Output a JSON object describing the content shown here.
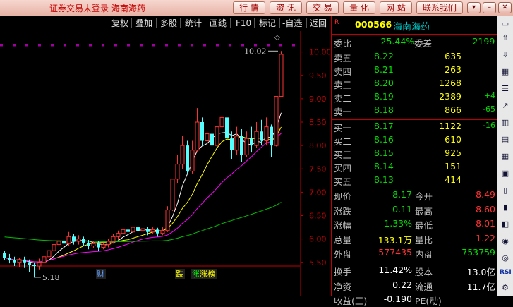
{
  "title": "证券交易未登录  海南海药",
  "top_buttons": [
    "行 情",
    "资 讯",
    "交 易",
    "量 化",
    "网 站",
    "联系我们"
  ],
  "toolbar": [
    "复权",
    "叠加",
    "多股",
    "统计",
    "画线",
    "F10",
    "标记",
    "-自选",
    "返回"
  ],
  "stock": {
    "badge": "R",
    "code": "000566",
    "name": "海南海药"
  },
  "webi": {
    "label1": "委比",
    "val1": "-25.44%",
    "label2": "委差",
    "val2": "-2199"
  },
  "asks": [
    {
      "label": "卖五",
      "price": "8.22",
      "vol": "635",
      "chg": ""
    },
    {
      "label": "卖四",
      "price": "8.21",
      "vol": "263",
      "chg": ""
    },
    {
      "label": "卖三",
      "price": "8.20",
      "vol": "1268",
      "chg": ""
    },
    {
      "label": "卖二",
      "price": "8.19",
      "vol": "2389",
      "chg": "+4"
    },
    {
      "label": "卖一",
      "price": "8.18",
      "vol": "866",
      "chg": "-65"
    }
  ],
  "bids": [
    {
      "label": "买一",
      "price": "8.17",
      "vol": "1122",
      "chg": "-16"
    },
    {
      "label": "买二",
      "price": "8.16",
      "vol": "610",
      "chg": ""
    },
    {
      "label": "买三",
      "price": "8.15",
      "vol": "925",
      "chg": ""
    },
    {
      "label": "买四",
      "price": "8.14",
      "vol": "151",
      "chg": ""
    },
    {
      "label": "买五",
      "price": "8.13",
      "vol": "414",
      "chg": ""
    }
  ],
  "stats": [
    {
      "l1": "现价",
      "v1": "8.17",
      "l2": "今开",
      "v2": "8.49"
    },
    {
      "l1": "涨跌",
      "v1": "-0.11",
      "l2": "最高",
      "v2": "8.60"
    },
    {
      "l1": "涨幅",
      "v1": "-1.33%",
      "l2": "最低",
      "v2": "8.01"
    },
    {
      "l1": "总量",
      "v1": "133.1万",
      "l2": "量比",
      "v2": "1.22"
    },
    {
      "l1": "外盘",
      "v1": "577435",
      "l2": "内盘",
      "v2": "753759"
    }
  ],
  "stats2": [
    {
      "l1": "换手",
      "v1": "11.42%",
      "l2": "股本",
      "v2": "13.0亿"
    },
    {
      "l1": "净资",
      "v1": "0.22",
      "l2": "流通",
      "v2": "11.7亿"
    },
    {
      "l1": "收益(三)",
      "v1": "-0.190",
      "l2": "PE(动)",
      "v2": ""
    }
  ],
  "chart_data": {
    "type": "candlestick",
    "y_ticks": [
      "10.00",
      "9.50",
      "9.00",
      "8.50",
      "8.00",
      "7.50",
      "7.00",
      "6.50",
      "6.00",
      "5.50"
    ],
    "ylim": [
      5.3,
      10.1
    ],
    "high_label": "10.02",
    "low_label": "5.18",
    "markers": [
      "财",
      "跌",
      "涨",
      "涨榜"
    ],
    "candles": [
      [
        5.7,
        5.6,
        5.75,
        5.55
      ],
      [
        5.6,
        5.55,
        5.68,
        5.48
      ],
      [
        5.55,
        5.5,
        5.62,
        5.42
      ],
      [
        5.5,
        5.56,
        5.6,
        5.4
      ],
      [
        5.56,
        5.5,
        5.62,
        5.38
      ],
      [
        5.5,
        5.45,
        5.56,
        5.3
      ],
      [
        5.45,
        5.42,
        5.5,
        5.18
      ],
      [
        5.42,
        5.5,
        5.58,
        5.35
      ],
      [
        5.5,
        5.62,
        5.7,
        5.45
      ],
      [
        5.62,
        5.75,
        5.82,
        5.55
      ],
      [
        5.75,
        5.88,
        5.95,
        5.7
      ],
      [
        5.88,
        5.95,
        6.05,
        5.8
      ],
      [
        5.95,
        5.9,
        6.02,
        5.82
      ],
      [
        5.9,
        6.05,
        6.15,
        5.85
      ],
      [
        6.05,
        5.95,
        6.1,
        5.88
      ],
      [
        5.95,
        6.0,
        6.08,
        5.88
      ],
      [
        6.0,
        5.92,
        6.05,
        5.85
      ],
      [
        5.92,
        5.85,
        5.98,
        5.78
      ],
      [
        5.85,
        5.9,
        5.95,
        5.8
      ],
      [
        5.9,
        5.82,
        5.96,
        5.75
      ],
      [
        5.82,
        5.88,
        5.92,
        5.78
      ],
      [
        5.88,
        5.95,
        6.0,
        5.82
      ],
      [
        5.95,
        6.05,
        6.1,
        5.9
      ],
      [
        6.05,
        6.12,
        6.18,
        5.98
      ],
      [
        6.12,
        6.2,
        6.28,
        6.05
      ],
      [
        6.2,
        6.15,
        6.3,
        6.08
      ],
      [
        6.15,
        6.25,
        6.32,
        6.1
      ],
      [
        6.25,
        6.18,
        6.3,
        6.12
      ],
      [
        6.18,
        6.22,
        6.28,
        6.1
      ],
      [
        6.22,
        6.15,
        6.26,
        6.08
      ],
      [
        6.15,
        6.2,
        6.25,
        6.1
      ],
      [
        6.2,
        6.12,
        6.24,
        6.05
      ],
      [
        6.12,
        6.18,
        6.25,
        6.08
      ],
      [
        6.18,
        6.62,
        6.7,
        6.15
      ],
      [
        6.62,
        7.28,
        7.28,
        6.6
      ],
      [
        7.28,
        7.6,
        7.8,
        7.2
      ],
      [
        7.6,
        8.0,
        8.2,
        7.5
      ],
      [
        8.0,
        7.45,
        8.1,
        7.4
      ],
      [
        7.45,
        7.9,
        8.1,
        7.4
      ],
      [
        7.9,
        8.5,
        8.8,
        7.85
      ],
      [
        8.5,
        8.1,
        8.6,
        8.0
      ],
      [
        8.1,
        8.25,
        8.4,
        7.95
      ],
      [
        8.25,
        8.0,
        8.35,
        7.9
      ],
      [
        8.0,
        8.4,
        8.8,
        7.95
      ],
      [
        8.4,
        8.6,
        8.9,
        8.2
      ],
      [
        8.6,
        8.15,
        8.75,
        8.05
      ],
      [
        8.15,
        7.9,
        8.3,
        7.7
      ],
      [
        7.9,
        8.2,
        8.4,
        7.8
      ],
      [
        8.2,
        7.8,
        8.35,
        7.65
      ],
      [
        7.8,
        8.15,
        8.3,
        7.75
      ],
      [
        8.15,
        8.0,
        8.4,
        7.85
      ],
      [
        8.0,
        8.3,
        8.5,
        7.95
      ],
      [
        8.3,
        8.1,
        8.55,
        8.0
      ],
      [
        8.1,
        8.4,
        8.6,
        8.0
      ],
      [
        8.4,
        8.0,
        8.45,
        7.75
      ],
      [
        8.0,
        9.05,
        9.05,
        7.98
      ],
      [
        9.05,
        9.95,
        10.02,
        9.2
      ]
    ]
  }
}
